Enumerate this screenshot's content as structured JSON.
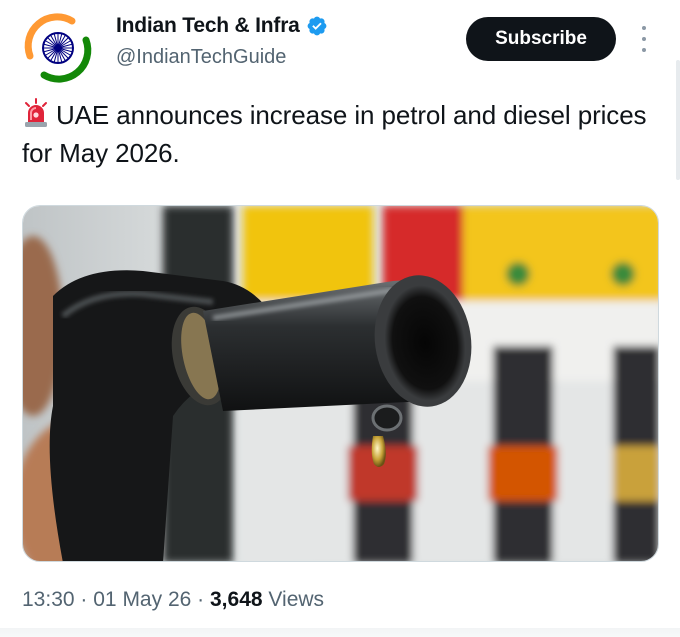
{
  "account": {
    "display_name": "Indian Tech & Infra",
    "handle": "@IndianTechGuide",
    "verified": true,
    "avatar_icon": "ashoka-chakra-logo-icon"
  },
  "actions": {
    "subscribe_label": "Subscribe",
    "more_icon": "more-vertical-icon"
  },
  "post": {
    "leading_emoji_icon": "police-siren-icon",
    "text": "UAE announces increase in petrol and diesel prices for May 2026.",
    "media_icon": "fuel-nozzle-photo"
  },
  "meta": {
    "time": "13:30",
    "separator": "·",
    "date": "01 May 26",
    "views_count": "3,648",
    "views_label": "Views"
  },
  "colors": {
    "primary_text": "#0f1419",
    "secondary_text": "#536471",
    "button_bg": "#0f1419",
    "verified_blue": "#1d9bf0",
    "saffron": "#ff9933",
    "india_green": "#138808",
    "chakra_navy": "#000080"
  }
}
